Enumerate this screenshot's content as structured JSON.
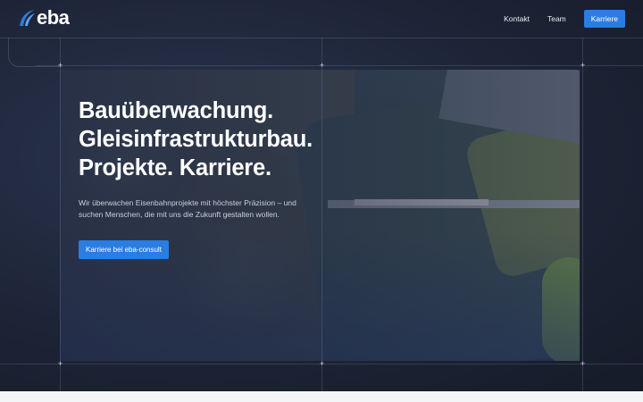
{
  "header": {
    "logo_text": "eba",
    "nav": {
      "kontakt": "Kontakt",
      "team": "Team",
      "karriere": "Karriere"
    }
  },
  "hero": {
    "line1": "Bauüberwachung.",
    "line2": "Gleisinfrastrukturbau.",
    "line3": "Projekte. Karriere.",
    "subtitle": "Wir überwachen Eisenbahnprojekte mit höchster Präzision – und suchen Menschen, die mit uns die Zukunft gestalten wollen.",
    "cta": "Karriere bei eba-consult"
  },
  "colors": {
    "accent": "#2a7de1",
    "background": "#1d2436"
  },
  "icons": {
    "logo": "eba-swoosh-logo",
    "grid_marker": "plus-marker"
  }
}
